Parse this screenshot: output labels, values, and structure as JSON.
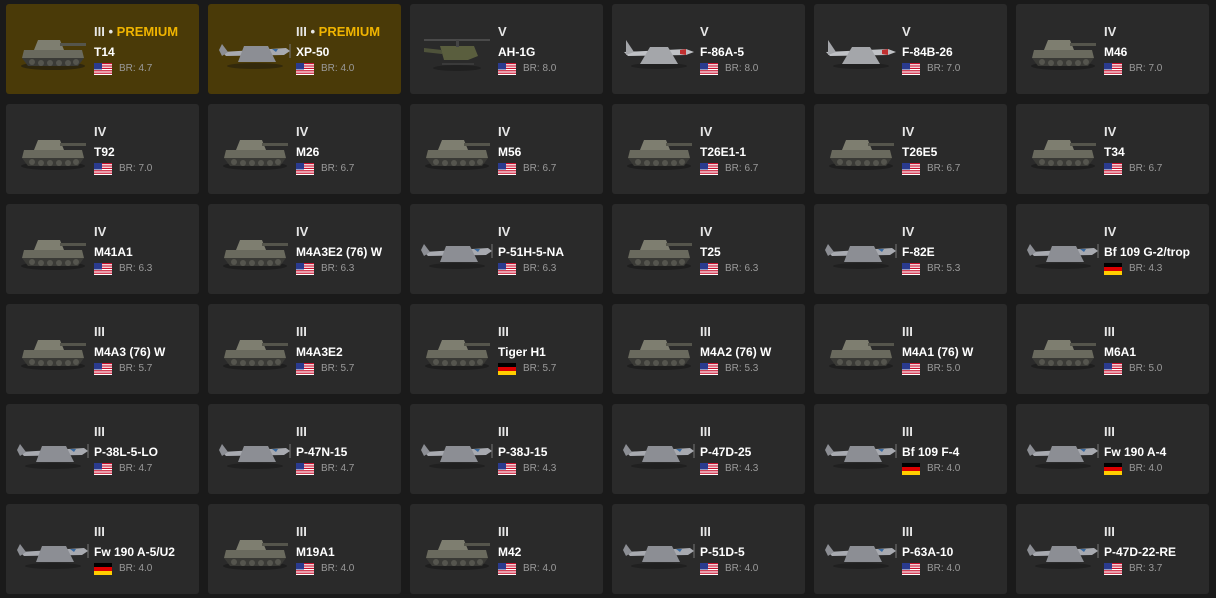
{
  "vehicles": [
    {
      "rank": "III",
      "premium": true,
      "premium_sep": "•",
      "premium_label": "PREMIUM",
      "name": "T14",
      "nation": "usa",
      "flag_icon": "usa-flag-icon",
      "br_label": "BR: 4.7",
      "kind": "tank"
    },
    {
      "rank": "III",
      "premium": true,
      "premium_sep": "•",
      "premium_label": "PREMIUM",
      "name": "XP-50",
      "nation": "usa",
      "flag_icon": "usa-flag-icon",
      "br_label": "BR: 4.0",
      "kind": "plane"
    },
    {
      "rank": "V",
      "name": "AH-1G",
      "nation": "usa",
      "flag_icon": "usa-flag-icon",
      "br_label": "BR: 8.0",
      "kind": "heli"
    },
    {
      "rank": "V",
      "name": "F-86A-5",
      "nation": "usa",
      "flag_icon": "usa-flag-icon",
      "br_label": "BR: 8.0",
      "kind": "jet"
    },
    {
      "rank": "V",
      "name": "F-84B-26",
      "nation": "usa",
      "flag_icon": "usa-flag-icon",
      "br_label": "BR: 7.0",
      "kind": "jet"
    },
    {
      "rank": "IV",
      "name": "M46",
      "nation": "usa",
      "flag_icon": "usa-flag-icon",
      "br_label": "BR: 7.0",
      "kind": "tank"
    },
    {
      "rank": "IV",
      "name": "T92",
      "nation": "usa",
      "flag_icon": "usa-flag-icon",
      "br_label": "BR: 7.0",
      "kind": "tank"
    },
    {
      "rank": "IV",
      "name": "M26",
      "nation": "usa",
      "flag_icon": "usa-flag-icon",
      "br_label": "BR: 6.7",
      "kind": "tank"
    },
    {
      "rank": "IV",
      "name": "M56",
      "nation": "usa",
      "flag_icon": "usa-flag-icon",
      "br_label": "BR: 6.7",
      "kind": "tank"
    },
    {
      "rank": "IV",
      "name": "T26E1-1",
      "nation": "usa",
      "flag_icon": "usa-flag-icon",
      "br_label": "BR: 6.7",
      "kind": "tank"
    },
    {
      "rank": "IV",
      "name": "T26E5",
      "nation": "usa",
      "flag_icon": "usa-flag-icon",
      "br_label": "BR: 6.7",
      "kind": "tank"
    },
    {
      "rank": "IV",
      "name": "T34",
      "nation": "usa",
      "flag_icon": "usa-flag-icon",
      "br_label": "BR: 6.7",
      "kind": "tank"
    },
    {
      "rank": "IV",
      "name": "M41A1",
      "nation": "usa",
      "flag_icon": "usa-flag-icon",
      "br_label": "BR: 6.3",
      "kind": "tank"
    },
    {
      "rank": "IV",
      "name": "M4A3E2 (76) W",
      "nation": "usa",
      "flag_icon": "usa-flag-icon",
      "br_label": "BR: 6.3",
      "kind": "tank"
    },
    {
      "rank": "IV",
      "name": "P-51H-5-NA",
      "nation": "usa",
      "flag_icon": "usa-flag-icon",
      "br_label": "BR: 6.3",
      "kind": "plane"
    },
    {
      "rank": "IV",
      "name": "T25",
      "nation": "usa",
      "flag_icon": "usa-flag-icon",
      "br_label": "BR: 6.3",
      "kind": "tank"
    },
    {
      "rank": "IV",
      "name": "F-82E",
      "nation": "usa",
      "flag_icon": "usa-flag-icon",
      "br_label": "BR: 5.3",
      "kind": "plane"
    },
    {
      "rank": "IV",
      "name": "Bf 109 G-2/trop",
      "nation": "germany",
      "flag_icon": "germany-flag-icon",
      "br_label": "BR: 4.3",
      "kind": "plane"
    },
    {
      "rank": "III",
      "name": "M4A3 (76) W",
      "nation": "usa",
      "flag_icon": "usa-flag-icon",
      "br_label": "BR: 5.7",
      "kind": "tank"
    },
    {
      "rank": "III",
      "name": "M4A3E2",
      "nation": "usa",
      "flag_icon": "usa-flag-icon",
      "br_label": "BR: 5.7",
      "kind": "tank"
    },
    {
      "rank": "III",
      "name": "Tiger H1",
      "nation": "germany",
      "flag_icon": "germany-flag-icon",
      "br_label": "BR: 5.7",
      "kind": "tank"
    },
    {
      "rank": "III",
      "name": "M4A2 (76) W",
      "nation": "usa",
      "flag_icon": "usa-flag-icon",
      "br_label": "BR: 5.3",
      "kind": "tank"
    },
    {
      "rank": "III",
      "name": "M4A1 (76) W",
      "nation": "usa",
      "flag_icon": "usa-flag-icon",
      "br_label": "BR: 5.0",
      "kind": "tank"
    },
    {
      "rank": "III",
      "name": "M6A1",
      "nation": "usa",
      "flag_icon": "usa-flag-icon",
      "br_label": "BR: 5.0",
      "kind": "tank"
    },
    {
      "rank": "III",
      "name": "P-38L-5-LO",
      "nation": "usa",
      "flag_icon": "usa-flag-icon",
      "br_label": "BR: 4.7",
      "kind": "plane"
    },
    {
      "rank": "III",
      "name": "P-47N-15",
      "nation": "usa",
      "flag_icon": "usa-flag-icon",
      "br_label": "BR: 4.7",
      "kind": "plane"
    },
    {
      "rank": "III",
      "name": "P-38J-15",
      "nation": "usa",
      "flag_icon": "usa-flag-icon",
      "br_label": "BR: 4.3",
      "kind": "plane"
    },
    {
      "rank": "III",
      "name": "P-47D-25",
      "nation": "usa",
      "flag_icon": "usa-flag-icon",
      "br_label": "BR: 4.3",
      "kind": "plane"
    },
    {
      "rank": "III",
      "name": "Bf 109 F-4",
      "nation": "germany",
      "flag_icon": "germany-flag-icon",
      "br_label": "BR: 4.0",
      "kind": "plane"
    },
    {
      "rank": "III",
      "name": "Fw 190 A-4",
      "nation": "germany",
      "flag_icon": "germany-flag-icon",
      "br_label": "BR: 4.0",
      "kind": "plane"
    },
    {
      "rank": "III",
      "name": "Fw 190 A-5/U2",
      "nation": "germany",
      "flag_icon": "germany-flag-icon",
      "br_label": "BR: 4.0",
      "kind": "plane"
    },
    {
      "rank": "III",
      "name": "M19A1",
      "nation": "usa",
      "flag_icon": "usa-flag-icon",
      "br_label": "BR: 4.0",
      "kind": "tank"
    },
    {
      "rank": "III",
      "name": "M42",
      "nation": "usa",
      "flag_icon": "usa-flag-icon",
      "br_label": "BR: 4.0",
      "kind": "tank"
    },
    {
      "rank": "III",
      "name": "P-51D-5",
      "nation": "usa",
      "flag_icon": "usa-flag-icon",
      "br_label": "BR: 4.0",
      "kind": "plane"
    },
    {
      "rank": "III",
      "name": "P-63A-10",
      "nation": "usa",
      "flag_icon": "usa-flag-icon",
      "br_label": "BR: 4.0",
      "kind": "plane"
    },
    {
      "rank": "III",
      "name": "P-47D-22-RE",
      "nation": "usa",
      "flag_icon": "usa-flag-icon",
      "br_label": "BR: 3.7",
      "kind": "plane"
    }
  ],
  "colors": {
    "card_bg": "#2a2a2a",
    "premium_card_bg": "#4a3a08",
    "premium_text": "#f0b400",
    "page_bg": "#1a1a1a"
  }
}
